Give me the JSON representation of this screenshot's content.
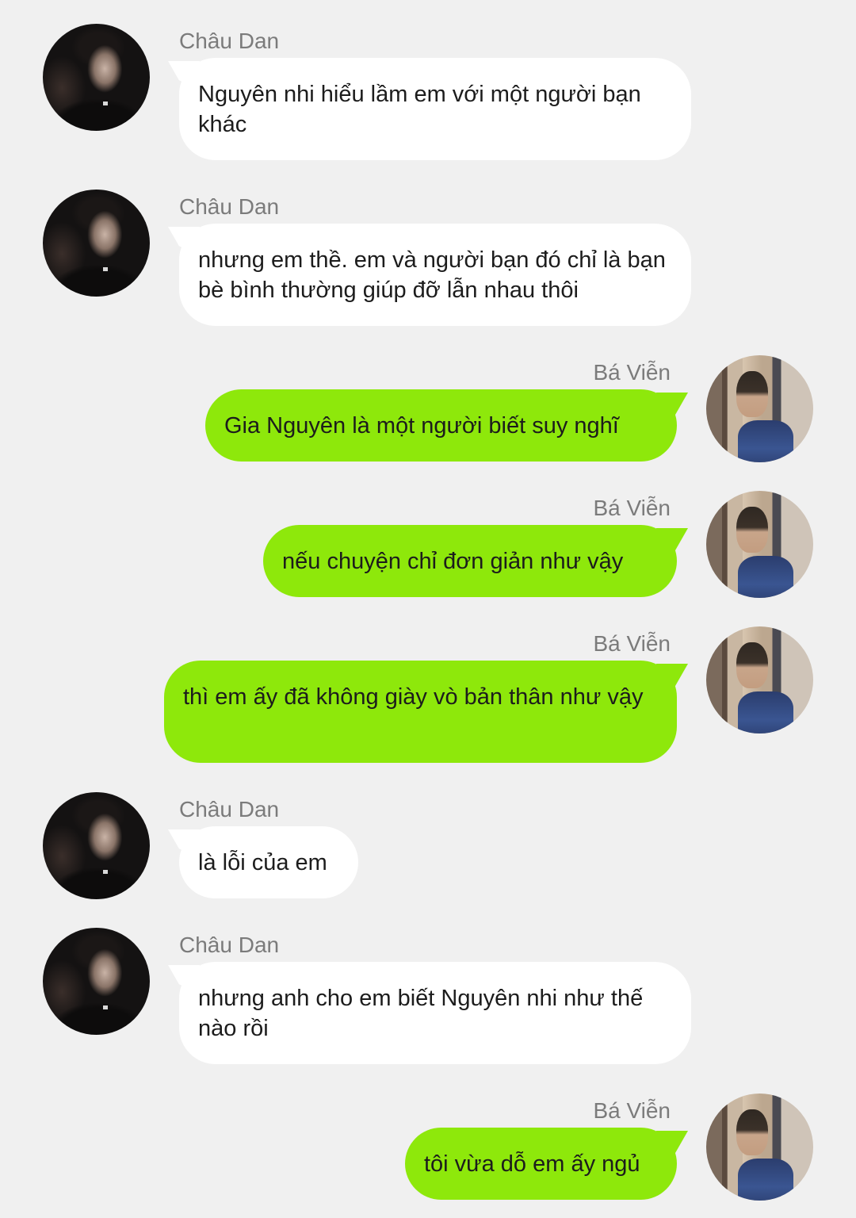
{
  "colors": {
    "background": "#f0f0f0",
    "incoming_bubble": "#ffffff",
    "outgoing_bubble": "#8ee80b",
    "name_text": "#7b7b7b",
    "message_text": "#1c1c1c"
  },
  "messages": [
    {
      "direction": "incoming",
      "sender": "Châu Dan",
      "avatar": "chau-dan-avatar",
      "text": "Nguyên nhi hiểu lầm em với một người bạn khác"
    },
    {
      "direction": "incoming",
      "sender": "Châu Dan",
      "avatar": "chau-dan-avatar",
      "text": "nhưng em thề. em và người bạn đó chỉ là bạn bè bình thường giúp đỡ lẫn nhau thôi"
    },
    {
      "direction": "outgoing",
      "sender": "Bá Viễn",
      "avatar": "ba-vien-avatar",
      "text": "Gia Nguyên là một người biết suy nghĩ"
    },
    {
      "direction": "outgoing",
      "sender": "Bá Viễn",
      "avatar": "ba-vien-avatar",
      "text": "nếu chuyện chỉ đơn giản như vậy"
    },
    {
      "direction": "outgoing",
      "sender": "Bá Viễn",
      "avatar": "ba-vien-avatar",
      "text": "thì em ấy đã không giày vò bản thân như vậy"
    },
    {
      "direction": "incoming",
      "sender": "Châu Dan",
      "avatar": "chau-dan-avatar",
      "text": "là lỗi của em"
    },
    {
      "direction": "incoming",
      "sender": "Châu Dan",
      "avatar": "chau-dan-avatar",
      "text": "nhưng anh cho em biết Nguyên nhi như thế nào rồi"
    },
    {
      "direction": "outgoing",
      "sender": "Bá Viễn",
      "avatar": "ba-vien-avatar",
      "text": "tôi vừa dỗ em ấy ngủ"
    }
  ]
}
